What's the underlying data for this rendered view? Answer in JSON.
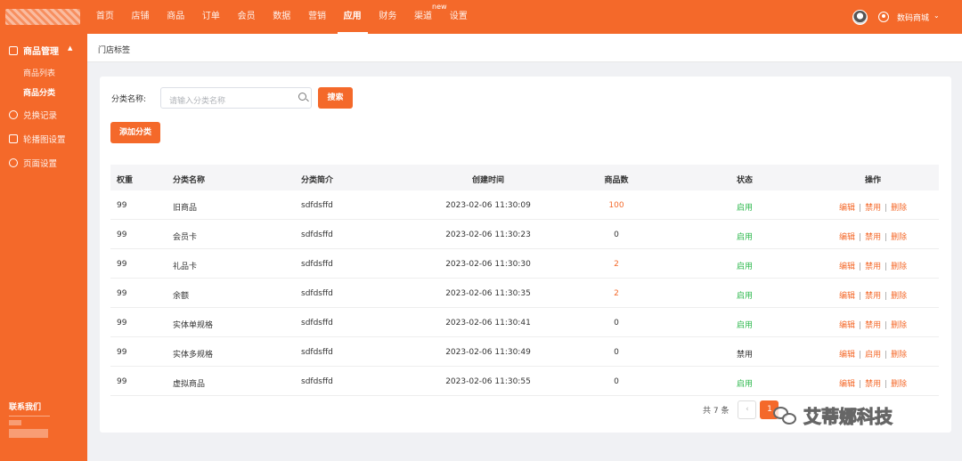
{
  "nav": {
    "items": [
      "首页",
      "店铺",
      "商品",
      "订单",
      "会员",
      "数据",
      "营销",
      "应用",
      "财务",
      "渠道",
      "设置"
    ],
    "active": "应用",
    "new_badge": "new"
  },
  "user": {
    "store_name": "数码商城"
  },
  "sidebar": {
    "group_label": "商品管理",
    "sub_items": [
      "商品列表",
      "商品分类"
    ],
    "active_sub": "商品分类",
    "items": [
      "兑换记录",
      "轮播图设置",
      "页面设置"
    ],
    "contact_label": "联系我们"
  },
  "tab": {
    "label": "门店标签"
  },
  "filter": {
    "label": "分类名称:",
    "placeholder": "请输入分类名称",
    "search_button": "搜索"
  },
  "add_button": "添加分类",
  "table": {
    "headers": [
      "权重",
      "分类名称",
      "分类简介",
      "创建时间",
      "商品数",
      "状态",
      "操作"
    ],
    "rows": [
      {
        "weight": "99",
        "name": "旧商品",
        "desc": "sdfdsffd",
        "time": "2023-02-06 11:30:09",
        "count": "100",
        "status": "启用",
        "ops": [
          "编辑",
          "禁用",
          "删除"
        ]
      },
      {
        "weight": "99",
        "name": "会员卡",
        "desc": "sdfdsffd",
        "time": "2023-02-06 11:30:23",
        "count": "0",
        "status": "启用",
        "ops": [
          "编辑",
          "禁用",
          "删除"
        ]
      },
      {
        "weight": "99",
        "name": "礼品卡",
        "desc": "sdfdsffd",
        "time": "2023-02-06 11:30:30",
        "count": "2",
        "status": "启用",
        "ops": [
          "编辑",
          "禁用",
          "删除"
        ]
      },
      {
        "weight": "99",
        "name": "余额",
        "desc": "sdfdsffd",
        "time": "2023-02-06 11:30:35",
        "count": "2",
        "status": "启用",
        "ops": [
          "编辑",
          "禁用",
          "删除"
        ]
      },
      {
        "weight": "99",
        "name": "实体单规格",
        "desc": "sdfdsffd",
        "time": "2023-02-06 11:30:41",
        "count": "0",
        "status": "启用",
        "ops": [
          "编辑",
          "禁用",
          "删除"
        ]
      },
      {
        "weight": "99",
        "name": "实体多规格",
        "desc": "sdfdsffd",
        "time": "2023-02-06 11:30:49",
        "count": "0",
        "status": "禁用",
        "ops": [
          "编辑",
          "启用",
          "删除"
        ]
      },
      {
        "weight": "99",
        "name": "虚拟商品",
        "desc": "sdfdsffd",
        "time": "2023-02-06 11:30:55",
        "count": "0",
        "status": "启用",
        "ops": [
          "编辑",
          "禁用",
          "删除"
        ]
      }
    ]
  },
  "pager": {
    "total": "共 7 条",
    "prev": "‹",
    "current_page": "1"
  },
  "watermark": {
    "text": "艾蒂娜科技"
  },
  "colors": {
    "brand": "#f4692a",
    "enabled": "#2db84d"
  }
}
